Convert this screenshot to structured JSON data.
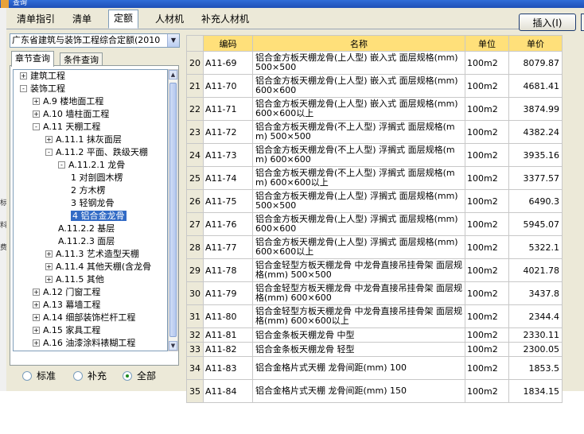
{
  "window": {
    "title": "查询"
  },
  "left_edge_glyphs": [
    "标",
    "料",
    "费"
  ],
  "top_tabs": [
    "清单指引",
    "清单",
    "定额",
    "人材机",
    "补充人材机"
  ],
  "active_top_tab": 2,
  "insert_button": "插入(I)",
  "quota_combo": {
    "value": "广东省建筑与装饰工程综合定额(2010"
  },
  "sub_tabs": [
    "章节查询",
    "条件查询"
  ],
  "tree": [
    {
      "label": "建筑工程",
      "level": 0,
      "toggle": "+"
    },
    {
      "label": "装饰工程",
      "level": 0,
      "toggle": "-"
    },
    {
      "label": "A.9 楼地面工程",
      "level": 1,
      "toggle": "+"
    },
    {
      "label": "A.10 墙柱面工程",
      "level": 1,
      "toggle": "+"
    },
    {
      "label": "A.11 天棚工程",
      "level": 1,
      "toggle": "-"
    },
    {
      "label": "A.11.1 抹灰面层",
      "level": 2,
      "toggle": "+"
    },
    {
      "label": "A.11.2 平面、跌级天棚",
      "level": 2,
      "toggle": "-"
    },
    {
      "label": "A.11.2.1 龙骨",
      "level": 3,
      "toggle": "-"
    },
    {
      "label": "1 对剖圆木楞",
      "level": 4,
      "toggle": ""
    },
    {
      "label": "2 方木楞",
      "level": 4,
      "toggle": ""
    },
    {
      "label": "3 轻钢龙骨",
      "level": 4,
      "toggle": ""
    },
    {
      "label": "4 铝合金龙骨",
      "level": 4,
      "toggle": "",
      "selected": true
    },
    {
      "label": "A.11.2.2 基层",
      "level": 3,
      "toggle": ""
    },
    {
      "label": "A.11.2.3 面层",
      "level": 3,
      "toggle": ""
    },
    {
      "label": "A.11.3 艺术造型天棚",
      "level": 2,
      "toggle": "+"
    },
    {
      "label": "A.11.4 其他天棚(含龙骨",
      "level": 2,
      "toggle": "+"
    },
    {
      "label": "A.11.5 其他",
      "level": 2,
      "toggle": "+"
    },
    {
      "label": "A.12 门窗工程",
      "level": 1,
      "toggle": "+"
    },
    {
      "label": "A.13 幕墙工程",
      "level": 1,
      "toggle": "+"
    },
    {
      "label": "A.14 细部装饰栏杆工程",
      "level": 1,
      "toggle": "+"
    },
    {
      "label": "A.15 家具工程",
      "level": 1,
      "toggle": "+"
    },
    {
      "label": "A.16 油漆涂料裱糊工程",
      "level": 1,
      "toggle": "+"
    }
  ],
  "radios": [
    {
      "label": "标准",
      "checked": false
    },
    {
      "label": "补充",
      "checked": false
    },
    {
      "label": "全部",
      "checked": true
    }
  ],
  "table": {
    "headers": [
      "",
      "编码",
      "名称",
      "单位",
      "单价"
    ],
    "rows": [
      {
        "n": "20",
        "code": "A11-69",
        "name": "铝合金方板天棚龙骨(上人型) 嵌入式 面层规格(mm) 500×500",
        "unit": "100m2",
        "price": "8079.87"
      },
      {
        "n": "21",
        "code": "A11-70",
        "name": "铝合金方板天棚龙骨(上人型) 嵌入式 面层规格(mm) 600×600",
        "unit": "100m2",
        "price": "4681.41"
      },
      {
        "n": "22",
        "code": "A11-71",
        "name": "铝合金方板天棚龙骨(上人型) 嵌入式 面层规格(mm) 600×600以上",
        "unit": "100m2",
        "price": "3874.99"
      },
      {
        "n": "23",
        "code": "A11-72",
        "name": "铝合金方板天棚龙骨(不上人型) 浮搁式 面层规格(mm) 500×500",
        "unit": "100m2",
        "price": "4382.24"
      },
      {
        "n": "24",
        "code": "A11-73",
        "name": "铝合金方板天棚龙骨(不上人型) 浮搁式 面层规格(mm) 600×600",
        "unit": "100m2",
        "price": "3935.16"
      },
      {
        "n": "25",
        "code": "A11-74",
        "name": "铝合金方板天棚龙骨(不上人型) 浮搁式 面层规格(mm) 600×600以上",
        "unit": "100m2",
        "price": "3377.57"
      },
      {
        "n": "26",
        "code": "A11-75",
        "name": "铝合金方板天棚龙骨(上人型) 浮搁式 面层规格(mm) 500×500",
        "unit": "100m2",
        "price": "6490.3"
      },
      {
        "n": "27",
        "code": "A11-76",
        "name": "铝合金方板天棚龙骨(上人型) 浮搁式 面层规格(mm) 600×600",
        "unit": "100m2",
        "price": "5945.07"
      },
      {
        "n": "28",
        "code": "A11-77",
        "name": "铝合金方板天棚龙骨(上人型) 浮搁式 面层规格(mm) 600×600以上",
        "unit": "100m2",
        "price": "5322.1"
      },
      {
        "n": "29",
        "code": "A11-78",
        "name": "铝合金轻型方板天棚龙骨 中龙骨直接吊挂骨架 面层规格(mm) 500×500",
        "unit": "100m2",
        "price": "4021.78"
      },
      {
        "n": "30",
        "code": "A11-79",
        "name": "铝合金轻型方板天棚龙骨 中龙骨直接吊挂骨架 面层规格(mm) 600×600",
        "unit": "100m2",
        "price": "3437.8"
      },
      {
        "n": "31",
        "code": "A11-80",
        "name": "铝合金轻型方板天棚龙骨 中龙骨直接吊挂骨架 面层规格(mm) 600×600以上",
        "unit": "100m2",
        "price": "2344.4"
      },
      {
        "n": "32",
        "code": "A11-81",
        "name": "铝合金条板天棚龙骨 中型",
        "unit": "100m2",
        "price": "2330.11"
      },
      {
        "n": "33",
        "code": "A11-82",
        "name": "铝合金条板天棚龙骨 轻型",
        "unit": "100m2",
        "price": "2300.05"
      },
      {
        "n": "34",
        "code": "A11-83",
        "name": "铝合金格片式天棚 龙骨间距(mm) 100",
        "unit": "100m2",
        "price": "1853.5"
      },
      {
        "n": "35",
        "code": "A11-84",
        "name": "铝合金格片式天棚 龙骨间距(mm) 150",
        "unit": "100m2",
        "price": "1834.15"
      }
    ]
  }
}
